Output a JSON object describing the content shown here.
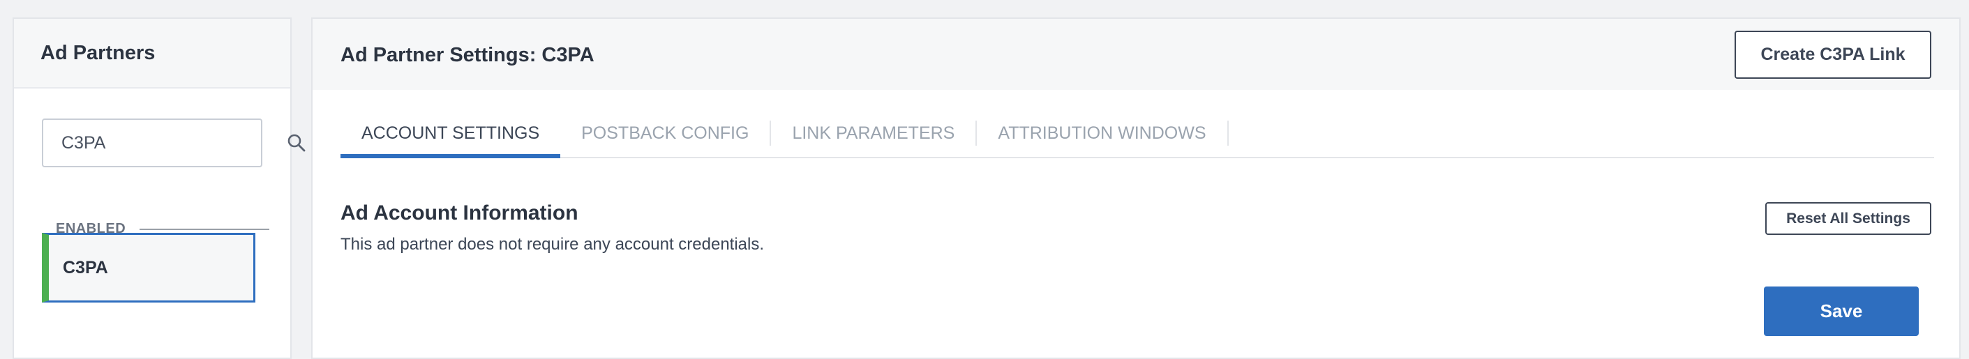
{
  "sidebar": {
    "title": "Ad Partners",
    "search": {
      "value": "C3PA",
      "icon": "search-icon"
    },
    "section_label": "ENABLED",
    "items": [
      {
        "label": "C3PA",
        "status_color": "#4caf50",
        "selected": true
      }
    ]
  },
  "main": {
    "title": "Ad Partner Settings: C3PA",
    "create_link_label": "Create C3PA Link",
    "tabs": [
      {
        "label": "ACCOUNT SETTINGS",
        "active": true
      },
      {
        "label": "POSTBACK CONFIG",
        "active": false
      },
      {
        "label": "LINK PARAMETERS",
        "active": false
      },
      {
        "label": "ATTRIBUTION WINDOWS",
        "active": false
      }
    ],
    "section": {
      "title": "Ad Account Information",
      "description": "This ad partner does not require any account credentials."
    },
    "reset_label": "Reset All Settings",
    "save_label": "Save"
  },
  "colors": {
    "accent": "#2e6ebf",
    "enabled": "#4caf50"
  }
}
